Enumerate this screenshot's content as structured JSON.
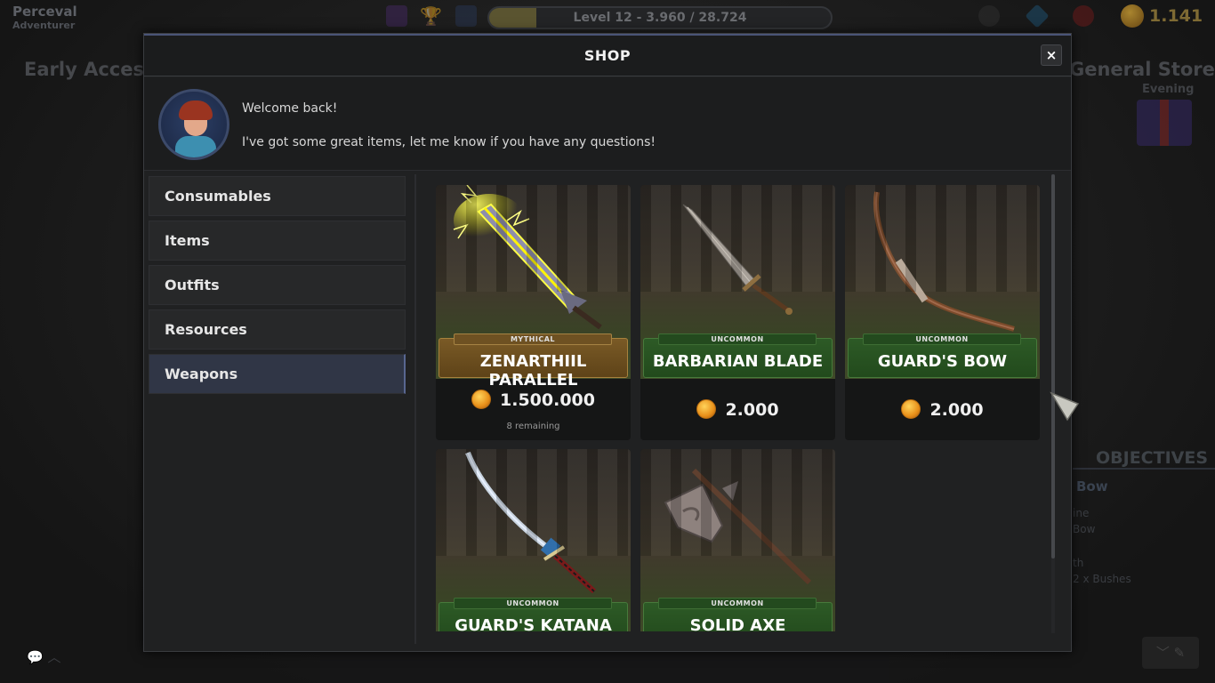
{
  "hud": {
    "player_name": "Perceval",
    "player_class": "Adventurer",
    "level_label": "Level 12 - 3.960 / 28.724",
    "level_progress": 0.138,
    "gold": "1.141"
  },
  "background": {
    "left_title": "Early Access",
    "right_title": "General Store",
    "time_of_day": "Evening",
    "objectives_title": "OBJECTIVES",
    "objective_item": "Bow",
    "objective_lines": [
      "ine",
      "Bow",
      "th",
      "2 x Bushes"
    ]
  },
  "shop": {
    "title": "SHOP",
    "close_label": "×",
    "welcome_line1": "Welcome back!",
    "welcome_line2": "I've got some great items, let me know if you have any questions!",
    "categories": [
      {
        "label": "Consumables"
      },
      {
        "label": "Items"
      },
      {
        "label": "Outfits"
      },
      {
        "label": "Resources"
      },
      {
        "label": "Weapons",
        "active": true
      }
    ],
    "items": [
      {
        "name": "ZENARTHIIL PARALLEL",
        "rarity": "MYTHICAL",
        "price": "1.500.000",
        "remaining": "8 remaining"
      },
      {
        "name": "BARBARIAN BLADE",
        "rarity": "UNCOMMON",
        "price": "2.000"
      },
      {
        "name": "GUARD'S BOW",
        "rarity": "UNCOMMON",
        "price": "2.000"
      },
      {
        "name": "GUARD'S KATANA",
        "rarity": "UNCOMMON",
        "price": ""
      },
      {
        "name": "SOLID AXE",
        "rarity": "UNCOMMON",
        "price": ""
      }
    ]
  },
  "colors": {
    "mythical": "#7a5a26",
    "uncommon": "#2d5a26",
    "accent": "#586690",
    "gold": "#f0a020"
  }
}
